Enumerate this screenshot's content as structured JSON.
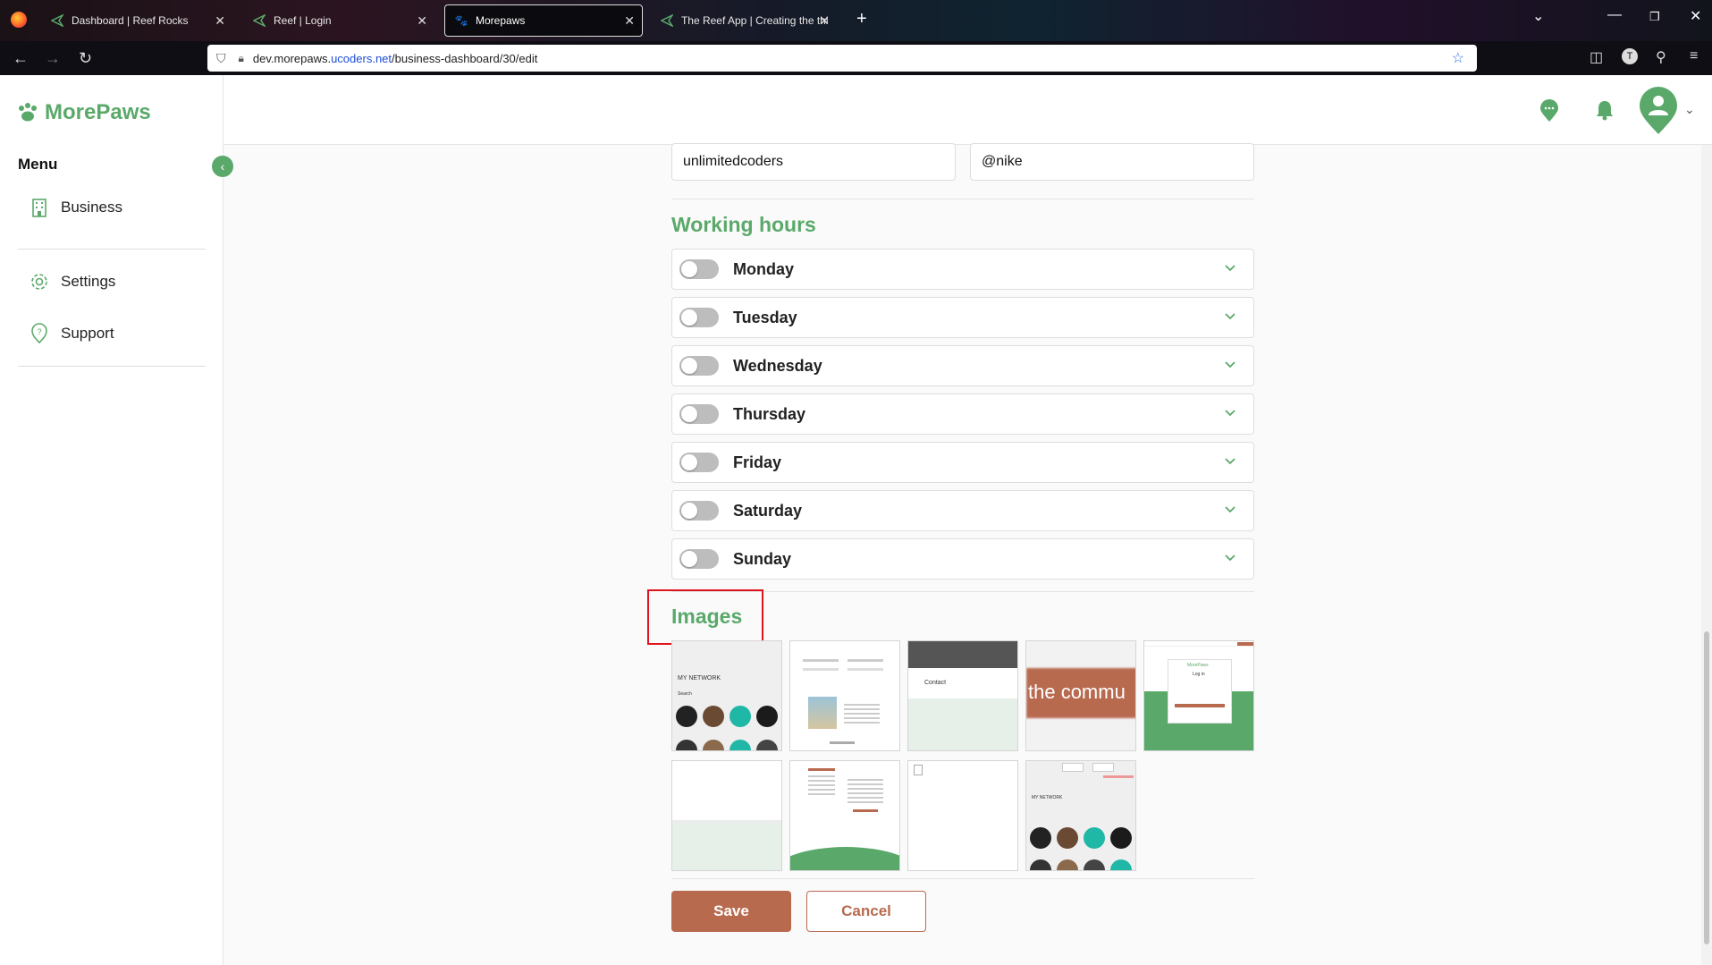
{
  "browser": {
    "tabs": [
      {
        "title": "Dashboard | Reef Rocks",
        "active": false
      },
      {
        "title": "Reef | Login",
        "active": false
      },
      {
        "title": "Morepaws",
        "active": true
      },
      {
        "title": "The Reef App | Creating the thi",
        "active": false
      }
    ],
    "new_tab": "+",
    "url_host": "dev.morepaws.",
    "url_domain": "ucoders.net",
    "url_path": "/business-dashboard/30/edit"
  },
  "app": {
    "logo_text": "MorePaws",
    "brand_color": "#5aa96a",
    "accent_color": "#b86a4f"
  },
  "sidebar": {
    "menu_title": "Menu",
    "items": [
      {
        "label": "Business",
        "icon": "building-icon"
      },
      {
        "label": "Settings",
        "icon": "gear-icon"
      },
      {
        "label": "Support",
        "icon": "help-pin-icon"
      }
    ]
  },
  "social": {
    "left_value": "unlimitedcoders",
    "right_value": "@nike"
  },
  "working_hours": {
    "title": "Working hours",
    "days": [
      {
        "label": "Monday",
        "enabled": false
      },
      {
        "label": "Tuesday",
        "enabled": false
      },
      {
        "label": "Wednesday",
        "enabled": false
      },
      {
        "label": "Thursday",
        "enabled": false
      },
      {
        "label": "Friday",
        "enabled": false
      },
      {
        "label": "Saturday",
        "enabled": false
      },
      {
        "label": "Sunday",
        "enabled": false
      }
    ]
  },
  "images": {
    "title": "Images",
    "thumb_texts": {
      "network": "MY NETWORK",
      "search": "Search",
      "contact": "Contact",
      "community": "the commu",
      "login_logo": "MorePaws",
      "login": "Log in"
    }
  },
  "actions": {
    "save_label": "Save",
    "cancel_label": "Cancel"
  }
}
